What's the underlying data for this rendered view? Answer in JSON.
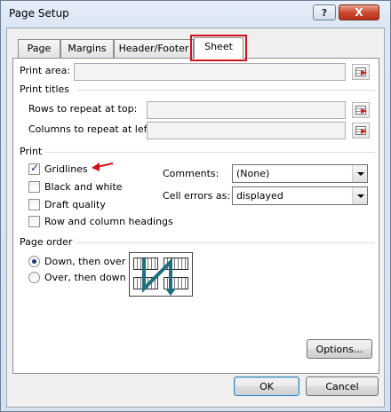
{
  "window": {
    "title": "Page Setup",
    "help_label": "?",
    "close_label": "X"
  },
  "tabs": [
    {
      "label": "Page"
    },
    {
      "label": "Margins"
    },
    {
      "label": "Header/Footer"
    },
    {
      "label": "Sheet",
      "active": true
    }
  ],
  "print_area": {
    "label": "Print area:",
    "value": ""
  },
  "print_titles": {
    "heading": "Print titles",
    "rows_label": "Rows to repeat at top:",
    "rows_value": "",
    "cols_label": "Columns to repeat at left:",
    "cols_value": ""
  },
  "print": {
    "heading": "Print",
    "gridlines": {
      "label": "Gridlines",
      "checked": true
    },
    "black_white": {
      "label": "Black and white",
      "checked": false
    },
    "draft": {
      "label": "Draft quality",
      "checked": false
    },
    "headings": {
      "label": "Row and column headings",
      "checked": false
    },
    "comments_label": "Comments:",
    "comments_value": "(None)",
    "cell_errors_label": "Cell errors as:",
    "cell_errors_value": "displayed"
  },
  "page_order": {
    "heading": "Page order",
    "down_over": {
      "label": "Down, then over",
      "selected": true
    },
    "over_down": {
      "label": "Over, then down",
      "selected": false
    }
  },
  "buttons": {
    "options": "Options...",
    "ok": "OK",
    "cancel": "Cancel"
  },
  "colors": {
    "highlight": "#d0121b",
    "accent": "#3c7fb1"
  }
}
